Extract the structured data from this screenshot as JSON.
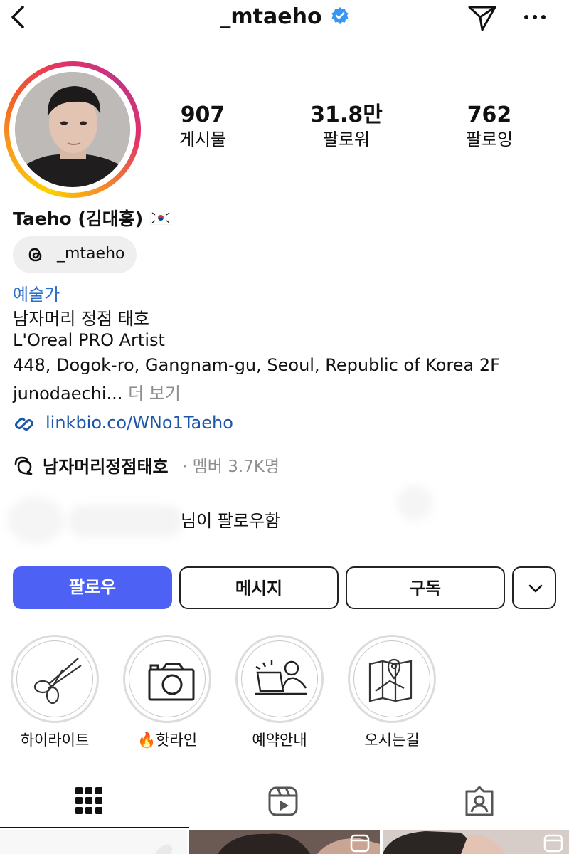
{
  "header": {
    "username": "_mtaeho",
    "icons": [
      "back-arrow-icon",
      "verified-badge-icon",
      "send-icon",
      "more-icon"
    ]
  },
  "stats": [
    {
      "value": "907",
      "label": "게시물"
    },
    {
      "value": "31.8만",
      "label": "팔로워"
    },
    {
      "value": "762",
      "label": "팔로잉"
    }
  ],
  "profile": {
    "name": "Taeho (김대홍)",
    "threads_handle": "_mtaeho",
    "category": "예술가",
    "bio_lines": [
      "남자머리 정점 태호",
      "L'Oreal PRO Artist",
      "448, Dogok-ro, Gangnam-gu, Seoul, Republic of Korea 2F"
    ],
    "bio_truncated": "junodaechi...",
    "more_label": "더 보기",
    "link": "linkbio.co/WNo1Taeho",
    "channel_name": "남자머리정점태호",
    "channel_meta": "· 멤버 3.7K명",
    "followed_by_text": "님이 팔로우함"
  },
  "buttons": {
    "follow": "팔로우",
    "message": "메시지",
    "subscribe": "구독"
  },
  "highlights": [
    {
      "label": "하이라이트",
      "icon": "scissors-icon"
    },
    {
      "label": "핫라인",
      "prefix": "🔥",
      "icon": "camera-icon"
    },
    {
      "label": "예약안내",
      "icon": "laptop-person-icon"
    },
    {
      "label": "오시는길",
      "icon": "map-icon"
    }
  ],
  "tabs": [
    "grid-icon",
    "reels-icon",
    "tagged-icon"
  ],
  "colors": {
    "follow_button": "#4d62f5",
    "link": "#1d58a8",
    "category": "#2e6fc6",
    "verified": "#3897f0"
  }
}
